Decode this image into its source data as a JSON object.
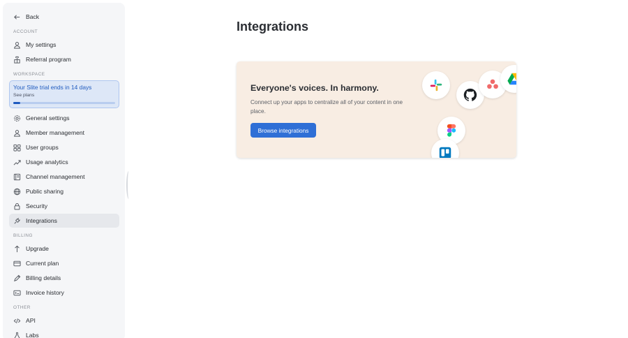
{
  "sidebar": {
    "back_label": "Back",
    "sections": {
      "account": "ACCOUNT",
      "workspace": "WORKSPACE",
      "billing": "BILLING",
      "other": "OTHER"
    },
    "account_items": [
      {
        "label": "My settings",
        "icon": "user-icon"
      },
      {
        "label": "Referral program",
        "icon": "gift-icon"
      }
    ],
    "trial": {
      "title": "Your Slite trial ends in 14 days",
      "link": "See plans",
      "progress": 0.07
    },
    "workspace_items": [
      {
        "label": "General settings",
        "icon": "gear-icon"
      },
      {
        "label": "Member management",
        "icon": "user-icon"
      },
      {
        "label": "User groups",
        "icon": "users-icon"
      },
      {
        "label": "Usage analytics",
        "icon": "trend-icon"
      },
      {
        "label": "Channel management",
        "icon": "book-icon"
      },
      {
        "label": "Public sharing",
        "icon": "globe-icon"
      },
      {
        "label": "Security",
        "icon": "lock-icon"
      },
      {
        "label": "Integrations",
        "icon": "plug-icon",
        "active": true
      }
    ],
    "billing_items": [
      {
        "label": "Upgrade",
        "icon": "arrow-up-icon"
      },
      {
        "label": "Current plan",
        "icon": "card-icon"
      },
      {
        "label": "Billing details",
        "icon": "pen-icon"
      },
      {
        "label": "Invoice history",
        "icon": "receipt-icon"
      }
    ],
    "other_items": [
      {
        "label": "API",
        "icon": "code-icon"
      },
      {
        "label": "Labs",
        "icon": "flask-icon"
      }
    ]
  },
  "main": {
    "title": "Integrations",
    "card": {
      "title": "Everyone's voices. In harmony.",
      "description": "Connect up your apps to centralize all of your content in one place.",
      "button_label": "Browse integrations",
      "logos": [
        "slack-logo",
        "github-logo",
        "asana-logo",
        "google-drive-logo",
        "figma-logo",
        "trello-logo"
      ]
    }
  },
  "colors": {
    "accent": "#2f6fd6",
    "card_bg": "#f8ede3",
    "sidebar_bg": "#f5f6f8",
    "trial_bg": "#dde7f7"
  }
}
